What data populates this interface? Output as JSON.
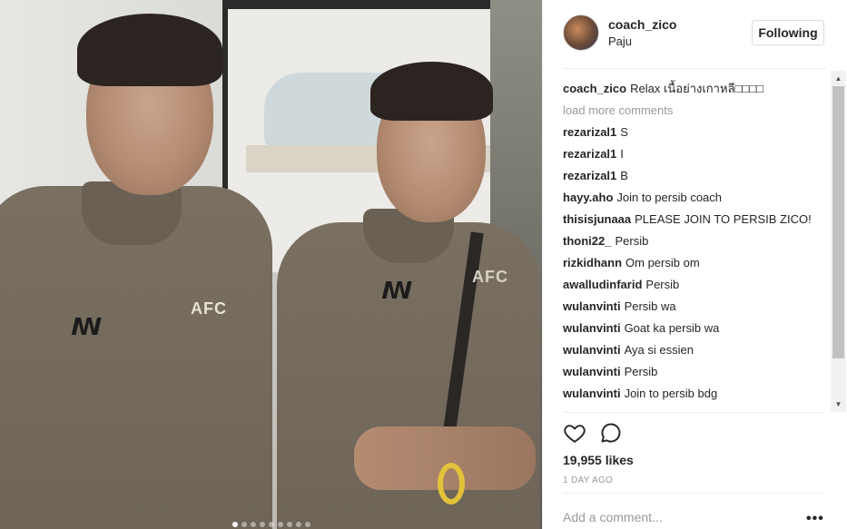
{
  "post": {
    "user": "coach_zico",
    "location": "Paju",
    "follow_label": "Following",
    "caption_author": "coach_zico",
    "caption_text": "Relax เนื้อย่างเกาหลี□□□□",
    "load_more": "load more comments",
    "comments": [
      {
        "author": "rezarizal1",
        "text": "S"
      },
      {
        "author": "rezarizal1",
        "text": "I"
      },
      {
        "author": "rezarizal1",
        "text": "B"
      },
      {
        "author": "hayy.aho",
        "text": "Join to persib coach"
      },
      {
        "author": "thisisjunaaa",
        "text": "PLEASE JOIN TO PERSIB ZICO!"
      },
      {
        "author": "thoni22_",
        "text": "Persib"
      },
      {
        "author": "rizkidhann",
        "text": "Om persib om"
      },
      {
        "author": "awalludinfarid",
        "text": "Persib"
      },
      {
        "author": "wulanvinti",
        "text": "Persib wa"
      },
      {
        "author": "wulanvinti",
        "text": "Goat ka persib wa"
      },
      {
        "author": "wulanvinti",
        "text": "Aya si essien"
      },
      {
        "author": "wulanvinti",
        "text": "Persib"
      },
      {
        "author": "wulanvinti",
        "text": "Join to persib bdg"
      }
    ],
    "likes": "19,955 likes",
    "time": "1 DAY AGO",
    "add_comment_placeholder": "Add a comment...",
    "more_label": "•••"
  },
  "photo": {
    "shirt_logo": "ꟿ",
    "badge_text": "AFC"
  },
  "icons": {
    "like": "heart-outline",
    "comment": "speech-bubble-outline",
    "scroll_up": "▲",
    "scroll_down": "▼"
  },
  "colors": {
    "text": "#262626",
    "muted": "#999999",
    "border": "#dbdbdb"
  }
}
